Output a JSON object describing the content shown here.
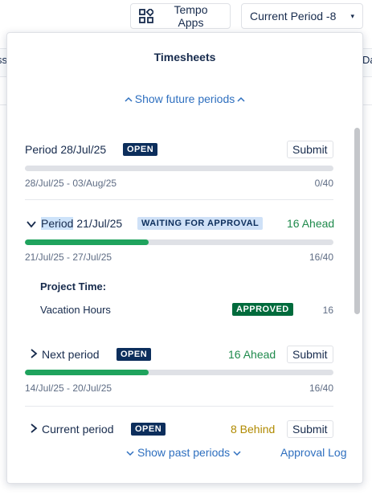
{
  "background": {
    "left_text": "ss",
    "right_text": "Da"
  },
  "topbar": {
    "tempo_apps_label": "Tempo Apps",
    "period_select_label": "Current Period -8",
    "period_caret": "▾"
  },
  "panel": {
    "title": "Timesheets",
    "show_future_label": "Show future periods",
    "show_past_label": "Show past periods",
    "approval_log_label": "Approval Log",
    "periods": [
      {
        "label": "Period 28/Jul/25",
        "badge": "OPEN",
        "action": "Submit",
        "date_range": "28/Jul/25 - 03/Aug/25",
        "hours": "0/40",
        "progress": 0
      },
      {
        "label_prefix": "Period",
        "label_suffix": " 21/Jul/25",
        "badge": "WAITING FOR APPROVAL",
        "status": "16 Ahead",
        "date_range": "21/Jul/25 - 27/Jul/25",
        "hours": "16/40",
        "progress": 0.4,
        "details": {
          "heading": "Project Time:",
          "item_label": "Vacation Hours",
          "item_badge": "APPROVED",
          "item_hours": "16"
        }
      },
      {
        "label": "Next period",
        "badge": "OPEN",
        "status": "16 Ahead",
        "action": "Submit",
        "date_range": "14/Jul/25 - 20/Jul/25",
        "hours": "16/40",
        "progress": 0.4
      },
      {
        "label": "Current period",
        "badge": "OPEN",
        "status": "8 Behind",
        "action": "Submit"
      }
    ]
  },
  "colors": {
    "accent_link": "#2e6fbf",
    "progress_green": "#1fa35d",
    "badge_open": "#0c2e5c",
    "badge_approved": "#006b3c",
    "ahead_text": "#1f8a4c",
    "behind_text": "#b08a00"
  },
  "icons": {
    "tempo_apps": "grid-apps-icon",
    "chevron_up": "chevron-up-icon",
    "chevron_down": "chevron-down-icon",
    "chevron_right": "chevron-right-icon"
  }
}
